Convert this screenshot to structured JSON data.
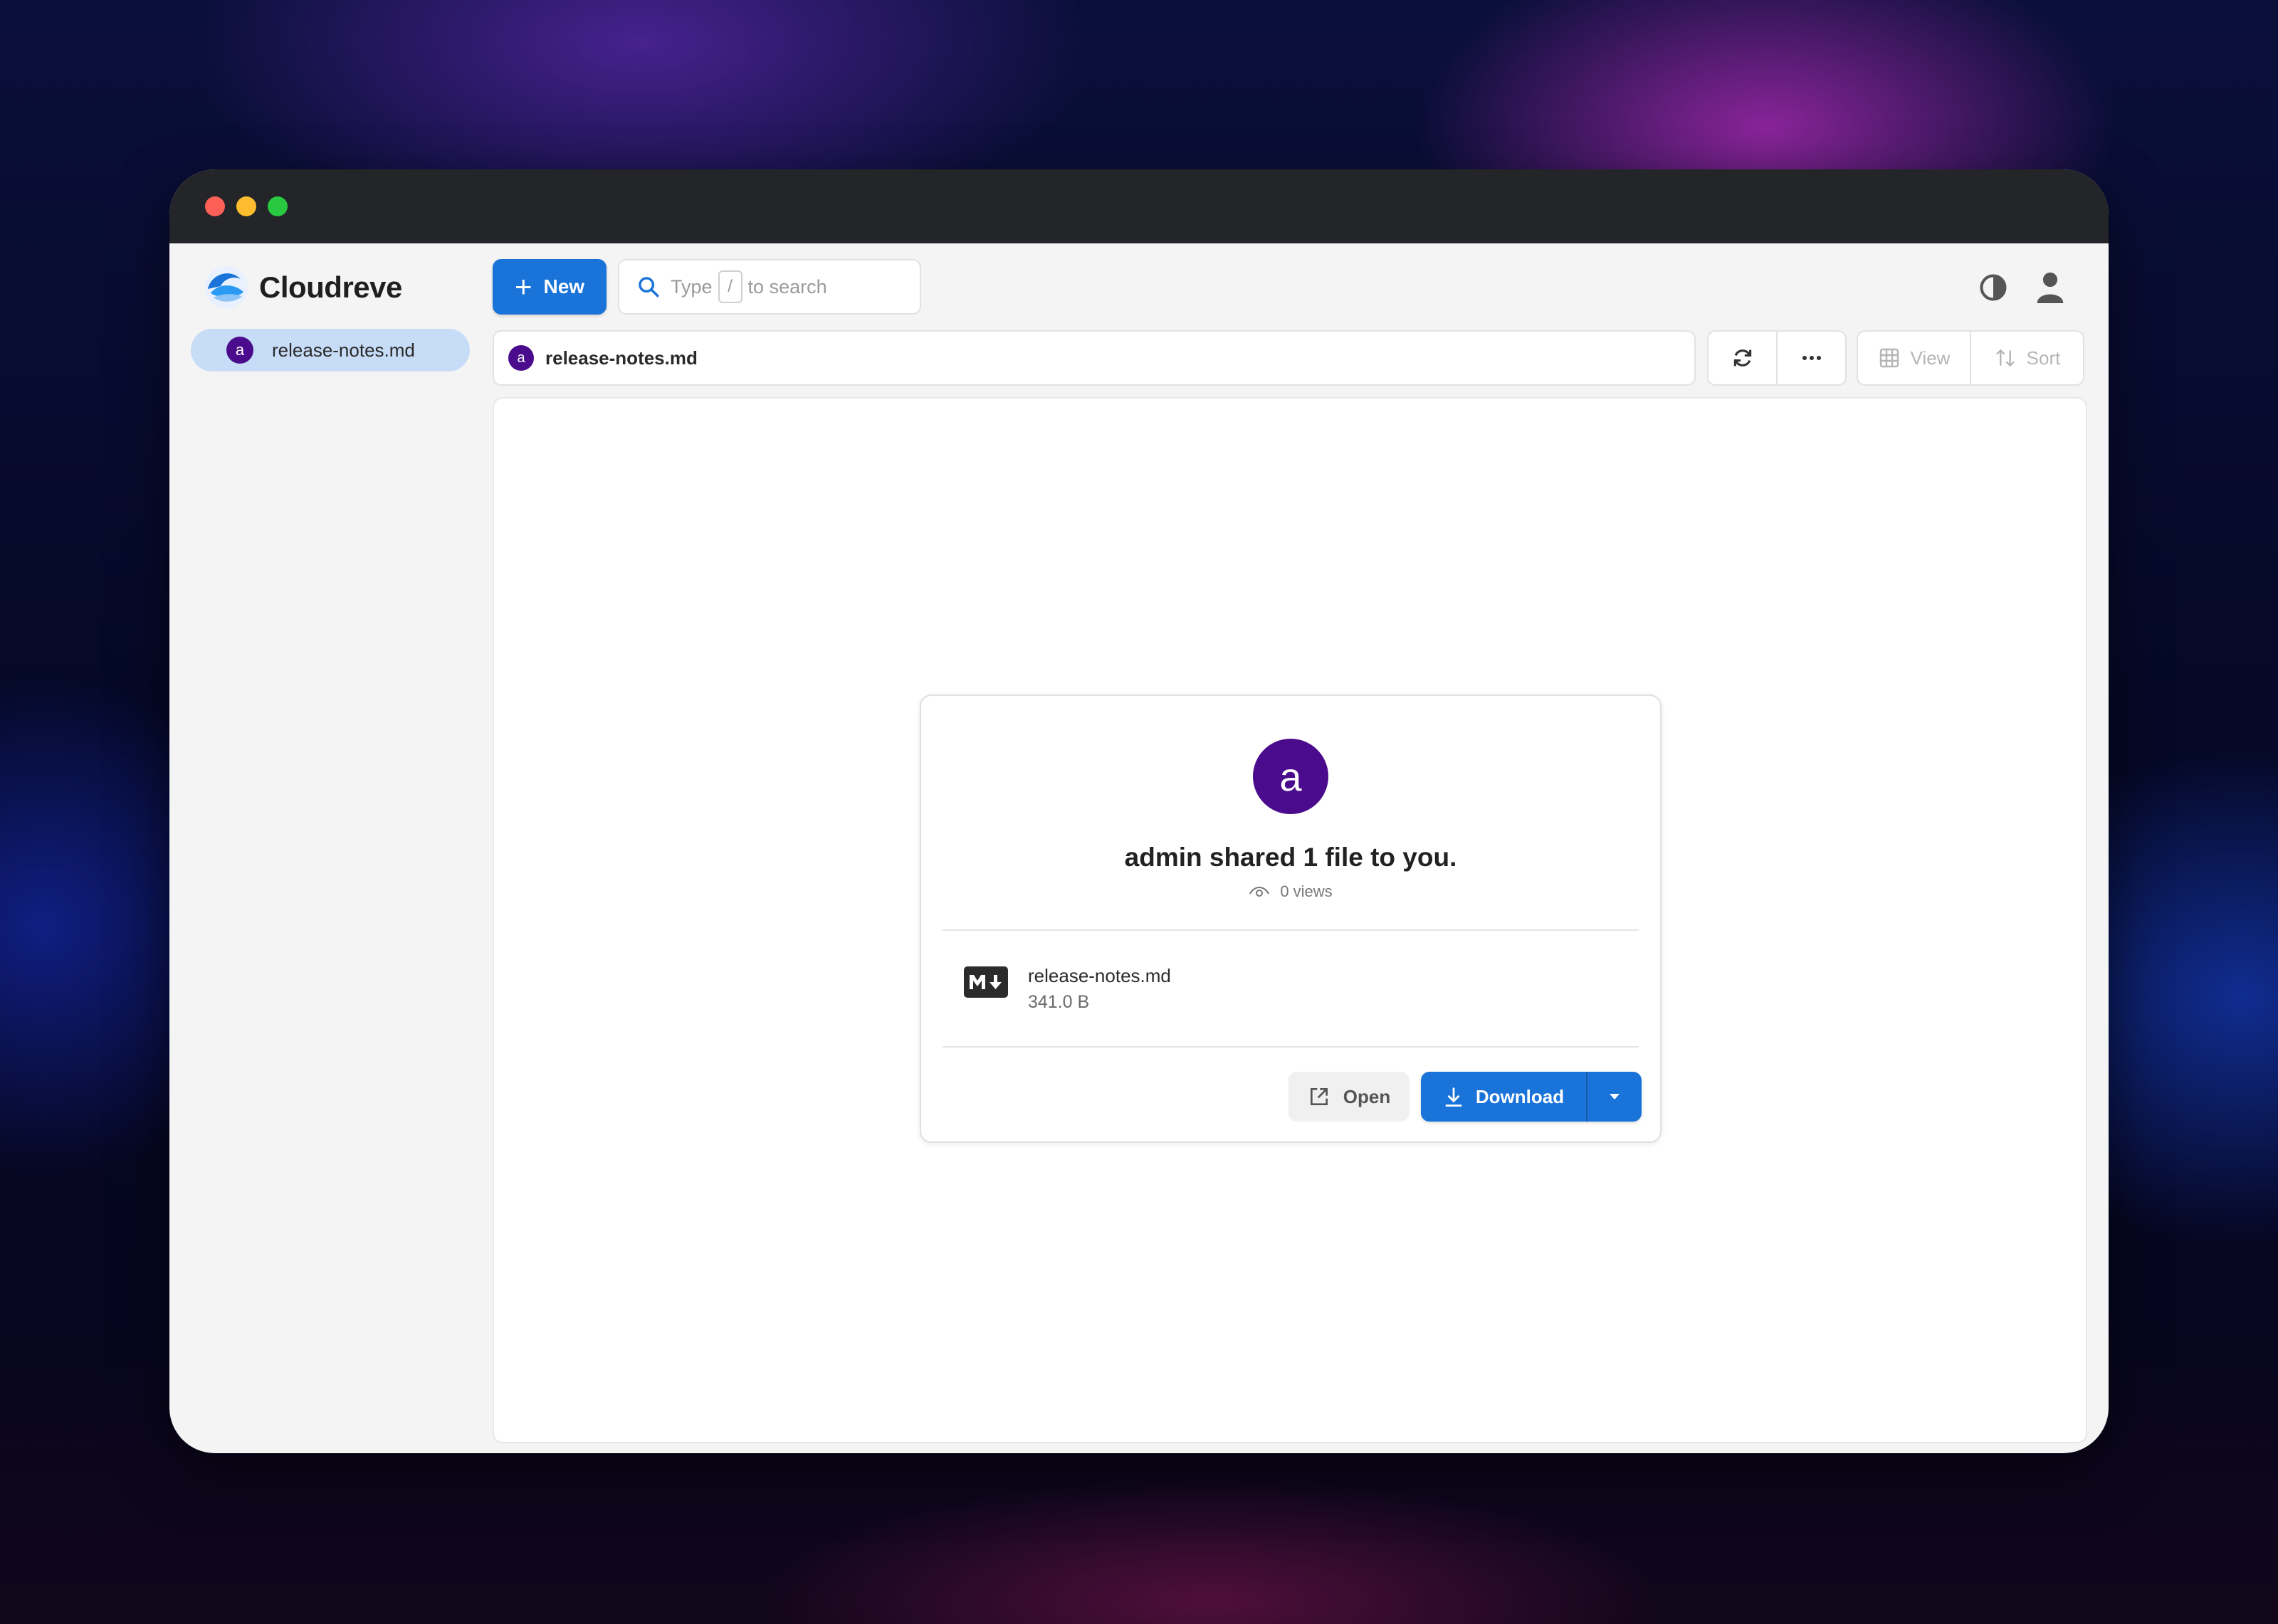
{
  "app": {
    "name": "Cloudreve"
  },
  "sidebar": {
    "items": [
      {
        "avatar": "a",
        "label": "release-notes.md"
      }
    ]
  },
  "toolbar": {
    "new_label": "New",
    "search": {
      "prefix": "Type",
      "key": "/",
      "suffix": "to search"
    },
    "view_label": "View",
    "sort_label": "Sort"
  },
  "path": {
    "avatar": "a",
    "label": "release-notes.md"
  },
  "share": {
    "avatar": "a",
    "title": "admin shared 1 file to you.",
    "views": "0 views",
    "file": {
      "name": "release-notes.md",
      "size": "341.0 B"
    },
    "open_label": "Open",
    "download_label": "Download"
  },
  "colors": {
    "accent": "#1a73d9",
    "avatar": "#4a0b8c",
    "titlebar": "#242528"
  }
}
